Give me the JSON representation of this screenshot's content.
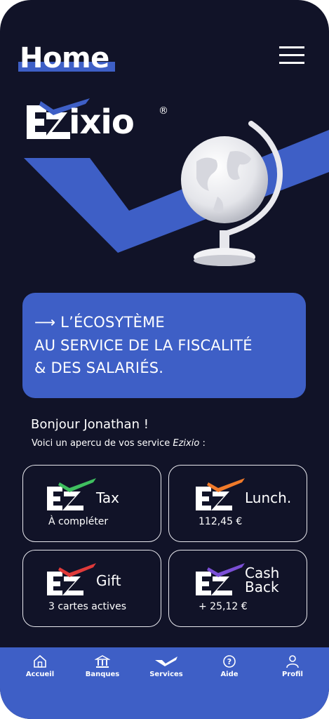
{
  "header": {
    "title": "Home"
  },
  "menu": {
    "icon": "hamburger-menu-icon"
  },
  "brand": {
    "name": "ixio",
    "registered": "®",
    "logo_mark": "EZ"
  },
  "hero": {
    "image": "globe",
    "accent_color": "#3e5fc6"
  },
  "promo": {
    "line1": "⟶ L’ÉCOSYTÈME",
    "line2": "AU SERVICE DE LA FISCALITÉ",
    "line3": "& DES SALARIÉS."
  },
  "greeting": {
    "title": "Bonjour Jonathan !",
    "subtitle_prefix": "Voici un apercu de vos service ",
    "subtitle_brand": "Ezixio",
    "subtitle_suffix": " :"
  },
  "services": [
    {
      "name": "Tax",
      "meta": "À compléter",
      "check_color": "#3fbf5f"
    },
    {
      "name": "Lunch.",
      "meta": "112,45 €",
      "check_color": "#f07a2a"
    },
    {
      "name": "Gift",
      "meta": "3 cartes actives",
      "check_color": "#e03a3a"
    },
    {
      "name_line1": "Cash",
      "name_line2": "Back",
      "meta": "+  25,12 €",
      "check_color": "#7b4fd6"
    }
  ],
  "nav": [
    {
      "label": "Accueil",
      "icon": "home-icon"
    },
    {
      "label": "Banques",
      "icon": "bank-icon"
    },
    {
      "label": "Services",
      "icon": "check-icon"
    },
    {
      "label": "Aide",
      "icon": "help-icon"
    },
    {
      "label": "Profil",
      "icon": "profile-icon"
    }
  ],
  "colors": {
    "background": "#111328",
    "accent": "#3e5fc6",
    "text": "#ffffff"
  }
}
